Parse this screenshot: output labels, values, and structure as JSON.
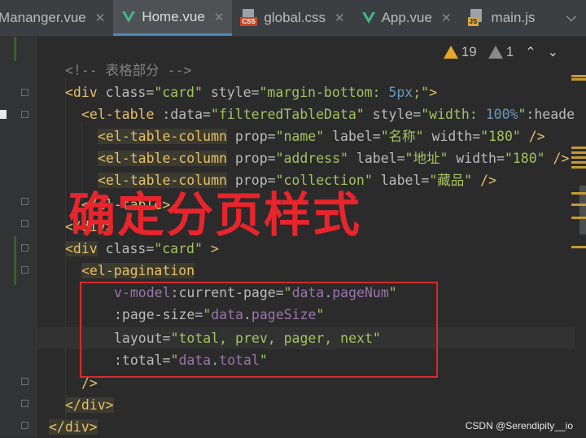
{
  "tabs": [
    {
      "label": "Mananger.vue",
      "icon": "none",
      "active": false
    },
    {
      "label": "Home.vue",
      "icon": "vue-icon",
      "active": true
    },
    {
      "label": "global.css",
      "icon": "css-file-icon",
      "active": false
    },
    {
      "label": "App.vue",
      "icon": "vue-icon",
      "active": false
    },
    {
      "label": "main.js",
      "icon": "js-file-icon",
      "active": false
    }
  ],
  "inspection": {
    "warnings": "19",
    "weak_warnings": "1"
  },
  "code": {
    "l1_comment": "<!-- 表格部分 -->",
    "l2_open": "<div",
    "l2_attr1": " class=",
    "l2_val1": "\"card\"",
    "l2_attr2": " style=",
    "l2_val2a": "\"margin-bottom: ",
    "l2_val2b": "5px",
    "l2_val2c": ";\"",
    "l2_close": ">",
    "l3_open": "<el-table",
    "l3_attr1": " :data=",
    "l3_val1": "\"filteredTableData\"",
    "l3_attr2": " style=",
    "l3_val2a": "\"width: ",
    "l3_val2b": "100%",
    "l3_val2c": "\"",
    "l3_attr3": ":header",
    "l4_tag": "<el-table-column",
    "l4_attr1": " prop=",
    "l4_val1": "\"name\"",
    "l4_attr2": " label=",
    "l4_val2": "\"名称\"",
    "l4_attr3": " width=",
    "l4_val3": "\"180\"",
    "l4_close": " />",
    "l5_tag": "<el-table-column",
    "l5_attr1": " prop=",
    "l5_val1": "\"address\"",
    "l5_attr2": " label=",
    "l5_val2": "\"地址\"",
    "l5_attr3": " width=",
    "l5_val3": "\"180\"",
    "l5_close": " />",
    "l6_tag": "<el-table-column",
    "l6_attr1": " prop=",
    "l6_val1": "\"collection\"",
    "l6_attr2": " label=",
    "l6_val2": "\"藏品\"",
    "l6_close": " />",
    "l7_tag": "</el-table>",
    "l8_tag": "</div>",
    "l9_open": "<div",
    "l9_attr": " class=",
    "l9_val": "\"card\"",
    "l9_close": " >",
    "l10_tag": "<el-pagination",
    "l11_attr": "v-model",
    "l11_attr2": ":current-page=",
    "l11_q1": "\"",
    "l11_val1": "data",
    "l11_dot": ".",
    "l11_val2": "pageNum",
    "l11_q2": "\"",
    "l12_attr": ":page-size=",
    "l12_q1": "\"",
    "l12_val1": "data",
    "l12_dot": ".",
    "l12_val2": "pageSize",
    "l12_q2": "\"",
    "l13_attr": "layout=",
    "l13_val": "\"total, prev, pager, next\"",
    "l14_attr": ":total=",
    "l14_q1": "\"",
    "l14_val1": "data",
    "l14_dot": ".",
    "l14_val2": "total",
    "l14_q2": "\"",
    "l15_tag": "/>",
    "l16_tag": "</div>",
    "l17_tag": "</div>"
  },
  "annotation": "确定分页样式",
  "watermark": "CSDN @Serendipity__io",
  "colors": {
    "annotation": "#e8242c",
    "box": "#d42a2a",
    "accent_tab": "#4a88c7"
  }
}
